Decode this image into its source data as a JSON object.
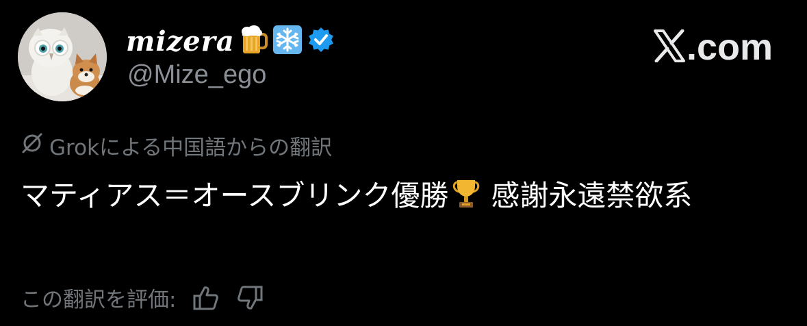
{
  "author": {
    "display_name": "mizera",
    "handle": "@Mize_ego",
    "name_emojis": [
      "beer-mug-icon",
      "snowflake-icon"
    ],
    "verified": true,
    "verified_color": "#1d9bf0"
  },
  "brand": {
    "label": ".com"
  },
  "translation": {
    "note": "Grokによる中国語からの翻訳"
  },
  "tweet": {
    "text_part1": "マティアス＝オースブリンク優勝",
    "trophy_icon": "trophy-icon",
    "text_part2": "感謝永遠禁欲系"
  },
  "rating": {
    "prompt": "この翻訳を評価:",
    "like_icon": "thumbs-up-icon",
    "dislike_icon": "thumbs-down-icon"
  },
  "colors": {
    "background": "#000000",
    "primary_text": "#ffffff",
    "secondary_text": "#71767b",
    "handle_text": "#8b9097"
  }
}
